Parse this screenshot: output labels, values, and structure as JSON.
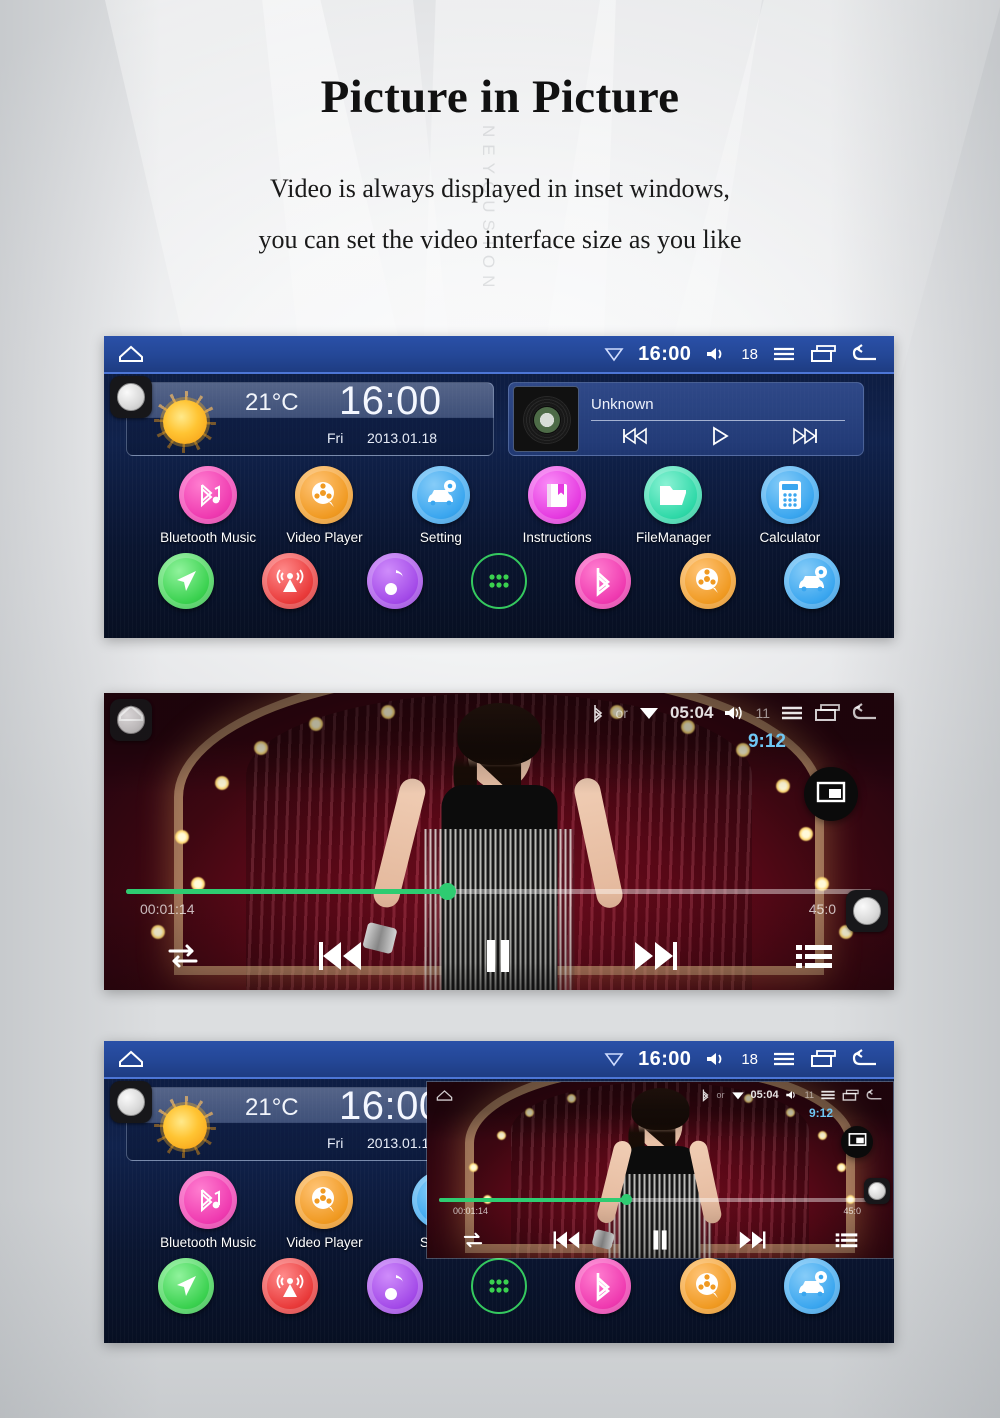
{
  "page": {
    "title": "Picture in Picture",
    "subtitle_line1": "Video is always displayed in inset windows,",
    "subtitle_line2": "you can set the video interface size as you like",
    "watermark": "NEYCUSTON"
  },
  "home_screen": {
    "statusbar": {
      "home_icon": "home-icon",
      "wifi_icon": "wifi-icon",
      "clock": "16:00",
      "volume_icon": "volume-icon",
      "volume_level": "18",
      "menu_icon": "menu-icon",
      "recents_icon": "recent-apps-icon",
      "back_icon": "back-icon"
    },
    "weather_widget": {
      "icon": "sun-icon",
      "temperature": "21°C",
      "time": "16:00",
      "weekday": "Fri",
      "date": "2013.01.18"
    },
    "music_widget": {
      "album_art": "vinyl-record-icon",
      "track_title": "Unknown",
      "prev_icon": "previous-track-icon",
      "play_icon": "play-icon",
      "next_icon": "next-track-icon"
    },
    "apps": [
      {
        "label": "Bluetooth Music",
        "icon": "bluetooth-music-icon",
        "color": "#ef3ab0"
      },
      {
        "label": "Video Player",
        "icon": "film-reel-icon",
        "color": "#f09a22"
      },
      {
        "label": "Setting",
        "icon": "car-gear-icon",
        "color": "#3aa6ef"
      },
      {
        "label": "Instructions",
        "icon": "book-icon",
        "color": "#e53ae0"
      },
      {
        "label": "FileManager",
        "icon": "folder-icon",
        "color": "#2fd9a8"
      },
      {
        "label": "Calculator",
        "icon": "calculator-icon",
        "color": "#3aa6ef"
      }
    ],
    "dock": [
      {
        "name": "navigation",
        "icon": "navigation-arrow-icon",
        "color": "#3ad14f"
      },
      {
        "name": "radio",
        "icon": "radio-tower-icon",
        "color": "#e93a3a"
      },
      {
        "name": "music",
        "icon": "music-note-icon",
        "color": "#a34ae8"
      },
      {
        "name": "app-drawer",
        "icon": "app-drawer-icon",
        "color": "#35c95f"
      },
      {
        "name": "bluetooth",
        "icon": "bluetooth-icon",
        "color": "#ef3ab0"
      },
      {
        "name": "video",
        "icon": "film-reel-icon",
        "color": "#f09a22"
      },
      {
        "name": "settings",
        "icon": "car-gear-icon",
        "color": "#3aa6ef"
      }
    ]
  },
  "video_player": {
    "statusbar": {
      "home_icon": "home-icon",
      "bluetooth_icon": "bluetooth-icon",
      "bluetooth_state": "or",
      "wifi_icon": "wifi-icon",
      "clock": "05:04",
      "volume_icon": "volume-icon",
      "volume_level": "11",
      "menu_icon": "menu-icon",
      "recents_icon": "recent-apps-icon",
      "back_icon": "back-icon"
    },
    "overlay_clock": "9:12",
    "pip_button_icon": "picture-in-picture-icon",
    "progress": {
      "elapsed": "00:01:14",
      "total": "45:0",
      "percent": 43
    },
    "controls": {
      "repeat_icon": "repeat-icon",
      "prev_icon": "previous-track-icon",
      "pause_icon": "pause-icon",
      "next_icon": "next-track-icon",
      "playlist_icon": "playlist-icon"
    }
  }
}
